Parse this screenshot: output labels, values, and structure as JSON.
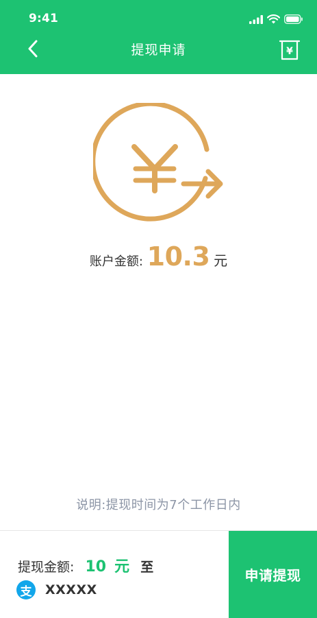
{
  "status": {
    "time": "9:41"
  },
  "nav": {
    "title": "提现申请",
    "receipt_icon_glyph": "¥"
  },
  "hero": {
    "icon_glyph": "¥",
    "color": "#dea75a"
  },
  "account": {
    "label": "账户金额:",
    "amount": "10.3",
    "unit": "元"
  },
  "note": "说明:提现时间为7个工作日内",
  "withdraw": {
    "label": "提现金额:",
    "amount": "10",
    "unit": "元",
    "to": "至",
    "alipay_icon_glyph": "支",
    "account_masked": "XXXXX",
    "button": "申请提现"
  },
  "colors": {
    "primary": "#1dc272",
    "accent": "#dea75a",
    "alipay": "#12a6ea"
  }
}
